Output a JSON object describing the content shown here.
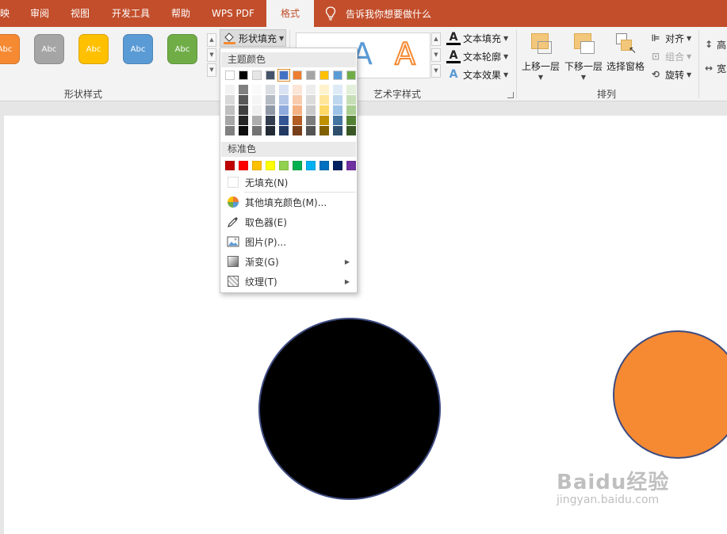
{
  "tabs": [
    {
      "label": "映"
    },
    {
      "label": "审阅"
    },
    {
      "label": "视图"
    },
    {
      "label": "开发工具"
    },
    {
      "label": "帮助"
    },
    {
      "label": "WPS PDF"
    },
    {
      "label": "格式",
      "active": true
    }
  ],
  "tell_me": "告诉我你想要做什么",
  "shape_styles": {
    "label": "形状样式",
    "items": [
      {
        "text": "Abc",
        "color": "#f58a33"
      },
      {
        "text": "Abc",
        "color": "#a5a5a5"
      },
      {
        "text": "Abc",
        "color": "#ffc000"
      },
      {
        "text": "Abc",
        "color": "#5b9bd5"
      },
      {
        "text": "Abc",
        "color": "#70ad47"
      }
    ]
  },
  "shape_fill": {
    "label": "形状填充",
    "menu": {
      "theme_header": "主题颜色",
      "theme_colors": [
        "#ffffff",
        "#000000",
        "#e7e6e6",
        "#44546a",
        "#4472c4",
        "#ed7d31",
        "#a5a5a5",
        "#ffc000",
        "#5b9bd5",
        "#70ad47"
      ],
      "selected_theme_index": 4,
      "standard_header": "标准色",
      "standard_colors": [
        "#c00000",
        "#ff0000",
        "#ffc000",
        "#ffff00",
        "#92d050",
        "#00b050",
        "#00b0f0",
        "#0070c0",
        "#002060",
        "#7030a0"
      ],
      "no_fill": "无填充(N)",
      "more_colors": "其他填充颜色(M)...",
      "eyedropper": "取色器(E)",
      "picture": "图片(P)...",
      "gradient": "渐变(G)",
      "texture": "纹理(T)"
    }
  },
  "wordart": {
    "label": "艺术字样式",
    "text_fill": "文本填充",
    "text_outline": "文本轮廓",
    "text_effects": "文本效果"
  },
  "arrange": {
    "label": "排列",
    "bring_forward": "上移一层",
    "send_backward": "下移一层",
    "selection_pane": "选择窗格",
    "align": "对齐",
    "group": "组合",
    "rotate": "旋转"
  },
  "size": {
    "height_label": "高",
    "width_label": "宽"
  },
  "slide": {
    "shapes": [
      {
        "name": "black-circle",
        "fill": "#000000"
      },
      {
        "name": "orange-circle",
        "fill": "#f58a33"
      }
    ]
  },
  "watermark": {
    "brand": "Baidu经验",
    "url": "jingyan.baidu.com"
  }
}
